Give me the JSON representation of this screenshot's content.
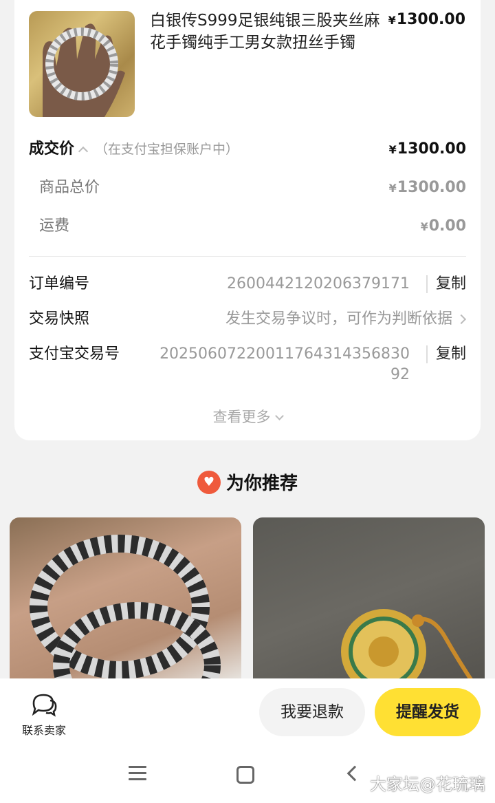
{
  "product": {
    "title": "白银传S999足银纯银三股夹丝麻花手镯纯手工男女款扭丝手镯",
    "price_symbol": "¥",
    "price": "1300.00"
  },
  "deal": {
    "label": "成交价",
    "sublabel": "（在支付宝担保账户中）",
    "price_symbol": "¥",
    "price": "1300.00"
  },
  "breakdown": [
    {
      "label": "商品总价",
      "symbol": "¥",
      "value": "1300.00"
    },
    {
      "label": "运费",
      "symbol": "¥",
      "value": "0.00"
    }
  ],
  "order_info": {
    "order_no_label": "订单编号",
    "order_no": "2600442120206379171",
    "copy_label": "复制",
    "snapshot_label": "交易快照",
    "snapshot_value": "发生交易争议时，可作为判断依据",
    "alipay_label": "支付宝交易号",
    "alipay_no_line1": "20250607220011764314356830",
    "alipay_no_line2": "92",
    "alipay_copy_label": "复制"
  },
  "see_more": "查看更多",
  "recommend": {
    "title": "为你推荐"
  },
  "bottom": {
    "contact_label": "联系卖家",
    "refund_label": "我要退款",
    "remind_label": "提醒发货"
  },
  "watermark": "大家坛@花琉璃",
  "colors": {
    "accent_yellow": "#ffe033",
    "recommend_red": "#ef5a3c"
  }
}
